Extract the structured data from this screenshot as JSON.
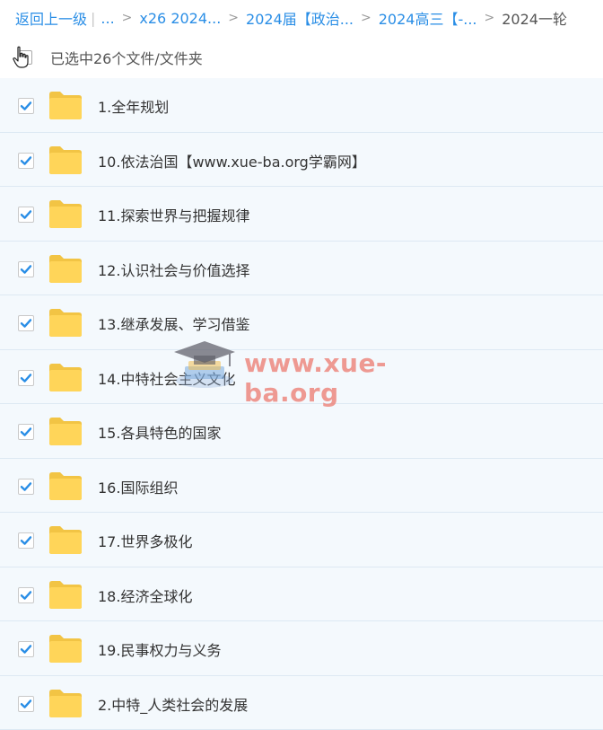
{
  "breadcrumb": {
    "back": "返回上一级",
    "sep": "|",
    "ellipsis": "...",
    "items": [
      "x26 2024...",
      "2024届【政治...",
      "2024高三【-..."
    ],
    "current": "2024一轮"
  },
  "selection": {
    "text": "已选中26个文件/文件夹"
  },
  "files": [
    "1.全年规划",
    "10.依法治国【www.xue-ba.org学霸网】",
    "11.探索世界与把握规律",
    "12.认识社会与价值选择",
    "13.继承发展、学习借鉴",
    "14.中特社会主义文化",
    "15.各具特色的国家",
    "16.国际组织",
    "17.世界多极化",
    "18.经济全球化",
    "19.民事权力与义务",
    "2.中特_人类社会的发展"
  ],
  "watermark": {
    "text": "www.xue-ba.org"
  },
  "colors": {
    "accent": "#2a8ee6",
    "folder": "#ffd559",
    "row_bg": "#f4f9fd"
  }
}
